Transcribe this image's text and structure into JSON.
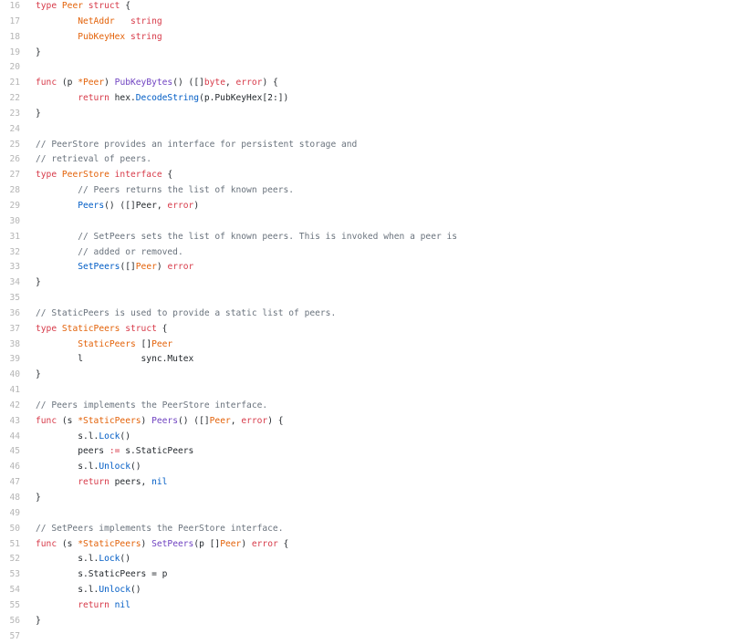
{
  "colors": {
    "keyword": "#d73a49",
    "function": "#6f42c1",
    "type": "#e36209",
    "comment": "#6a737d",
    "call": "#005cc5",
    "text": "#24292e",
    "line_number": "#b5b5b5",
    "background": "#ffffff"
  },
  "lines": [
    {
      "n": "16",
      "tokens": [
        [
          "kw",
          "type"
        ],
        [
          "t",
          " "
        ],
        [
          "type",
          "Peer"
        ],
        [
          "t",
          " "
        ],
        [
          "kw",
          "struct"
        ],
        [
          "t",
          " {"
        ]
      ]
    },
    {
      "n": "17",
      "tokens": [
        [
          "t",
          "\t"
        ],
        [
          "type",
          "NetAddr"
        ],
        [
          "t",
          "   "
        ],
        [
          "kw",
          "string"
        ]
      ]
    },
    {
      "n": "18",
      "tokens": [
        [
          "t",
          "\t"
        ],
        [
          "type",
          "PubKeyHex"
        ],
        [
          "t",
          " "
        ],
        [
          "kw",
          "string"
        ]
      ]
    },
    {
      "n": "19",
      "tokens": [
        [
          "t",
          "}"
        ]
      ]
    },
    {
      "n": "20",
      "tokens": []
    },
    {
      "n": "21",
      "tokens": [
        [
          "kw",
          "func"
        ],
        [
          "t",
          " (p "
        ],
        [
          "type",
          "*Peer"
        ],
        [
          "t",
          ") "
        ],
        [
          "fn",
          "PubKeyBytes"
        ],
        [
          "t",
          "() ([]"
        ],
        [
          "kw",
          "byte"
        ],
        [
          "t",
          ", "
        ],
        [
          "kw",
          "error"
        ],
        [
          "t",
          ") {"
        ]
      ]
    },
    {
      "n": "22",
      "tokens": [
        [
          "t",
          "\t"
        ],
        [
          "kw",
          "return"
        ],
        [
          "t",
          " hex."
        ],
        [
          "blue",
          "DecodeString"
        ],
        [
          "t",
          "(p.PubKeyHex[2:])"
        ]
      ]
    },
    {
      "n": "23",
      "tokens": [
        [
          "t",
          "}"
        ]
      ]
    },
    {
      "n": "24",
      "tokens": []
    },
    {
      "n": "25",
      "tokens": [
        [
          "com",
          "// PeerStore provides an interface for persistent storage and"
        ]
      ]
    },
    {
      "n": "26",
      "tokens": [
        [
          "com",
          "// retrieval of peers."
        ]
      ]
    },
    {
      "n": "27",
      "tokens": [
        [
          "kw",
          "type"
        ],
        [
          "t",
          " "
        ],
        [
          "type",
          "PeerStore"
        ],
        [
          "t",
          " "
        ],
        [
          "kw",
          "interface"
        ],
        [
          "t",
          " {"
        ]
      ]
    },
    {
      "n": "28",
      "tokens": [
        [
          "t",
          "\t"
        ],
        [
          "com",
          "// Peers returns the list of known peers."
        ]
      ]
    },
    {
      "n": "29",
      "tokens": [
        [
          "t",
          "\t"
        ],
        [
          "blue",
          "Peers"
        ],
        [
          "t",
          "() ([]Peer, "
        ],
        [
          "kw",
          "error"
        ],
        [
          "t",
          ")"
        ]
      ]
    },
    {
      "n": "30",
      "tokens": []
    },
    {
      "n": "31",
      "tokens": [
        [
          "t",
          "\t"
        ],
        [
          "com",
          "// SetPeers sets the list of known peers. This is invoked when a peer is"
        ]
      ]
    },
    {
      "n": "32",
      "tokens": [
        [
          "t",
          "\t"
        ],
        [
          "com",
          "// added or removed."
        ]
      ]
    },
    {
      "n": "33",
      "tokens": [
        [
          "t",
          "\t"
        ],
        [
          "blue",
          "SetPeers"
        ],
        [
          "t",
          "([]"
        ],
        [
          "type",
          "Peer"
        ],
        [
          "t",
          ") "
        ],
        [
          "kw",
          "error"
        ]
      ]
    },
    {
      "n": "34",
      "tokens": [
        [
          "t",
          "}"
        ]
      ]
    },
    {
      "n": "35",
      "tokens": []
    },
    {
      "n": "36",
      "tokens": [
        [
          "com",
          "// StaticPeers is used to provide a static list of peers."
        ]
      ]
    },
    {
      "n": "37",
      "tokens": [
        [
          "kw",
          "type"
        ],
        [
          "t",
          " "
        ],
        [
          "type",
          "StaticPeers"
        ],
        [
          "t",
          " "
        ],
        [
          "kw",
          "struct"
        ],
        [
          "t",
          " {"
        ]
      ]
    },
    {
      "n": "38",
      "tokens": [
        [
          "t",
          "\t"
        ],
        [
          "type",
          "StaticPeers"
        ],
        [
          "t",
          " []"
        ],
        [
          "type",
          "Peer"
        ]
      ]
    },
    {
      "n": "39",
      "tokens": [
        [
          "t",
          "\tl           sync.Mutex"
        ]
      ]
    },
    {
      "n": "40",
      "tokens": [
        [
          "t",
          "}"
        ]
      ]
    },
    {
      "n": "41",
      "tokens": []
    },
    {
      "n": "42",
      "tokens": [
        [
          "com",
          "// Peers implements the PeerStore interface."
        ]
      ]
    },
    {
      "n": "43",
      "tokens": [
        [
          "kw",
          "func"
        ],
        [
          "t",
          " (s "
        ],
        [
          "type",
          "*StaticPeers"
        ],
        [
          "t",
          ") "
        ],
        [
          "fn",
          "Peers"
        ],
        [
          "t",
          "() ([]"
        ],
        [
          "type",
          "Peer"
        ],
        [
          "t",
          ", "
        ],
        [
          "kw",
          "error"
        ],
        [
          "t",
          ") {"
        ]
      ]
    },
    {
      "n": "44",
      "tokens": [
        [
          "t",
          "\ts.l."
        ],
        [
          "blue",
          "Lock"
        ],
        [
          "t",
          "()"
        ]
      ]
    },
    {
      "n": "45",
      "tokens": [
        [
          "t",
          "\tpeers "
        ],
        [
          "kw",
          ":="
        ],
        [
          "t",
          " s.StaticPeers"
        ]
      ]
    },
    {
      "n": "46",
      "tokens": [
        [
          "t",
          "\ts.l."
        ],
        [
          "blue",
          "Unlock"
        ],
        [
          "t",
          "()"
        ]
      ]
    },
    {
      "n": "47",
      "tokens": [
        [
          "t",
          "\t"
        ],
        [
          "kw",
          "return"
        ],
        [
          "t",
          " peers, "
        ],
        [
          "blue",
          "nil"
        ]
      ]
    },
    {
      "n": "48",
      "tokens": [
        [
          "t",
          "}"
        ]
      ]
    },
    {
      "n": "49",
      "tokens": []
    },
    {
      "n": "50",
      "tokens": [
        [
          "com",
          "// SetPeers implements the PeerStore interface."
        ]
      ]
    },
    {
      "n": "51",
      "tokens": [
        [
          "kw",
          "func"
        ],
        [
          "t",
          " (s "
        ],
        [
          "type",
          "*StaticPeers"
        ],
        [
          "t",
          ") "
        ],
        [
          "fn",
          "SetPeers"
        ],
        [
          "t",
          "(p []"
        ],
        [
          "type",
          "Peer"
        ],
        [
          "t",
          ") "
        ],
        [
          "kw",
          "error"
        ],
        [
          "t",
          " {"
        ]
      ]
    },
    {
      "n": "52",
      "tokens": [
        [
          "t",
          "\ts.l."
        ],
        [
          "blue",
          "Lock"
        ],
        [
          "t",
          "()"
        ]
      ]
    },
    {
      "n": "53",
      "tokens": [
        [
          "t",
          "\ts.StaticPeers = p"
        ]
      ]
    },
    {
      "n": "54",
      "tokens": [
        [
          "t",
          "\ts.l."
        ],
        [
          "blue",
          "Unlock"
        ],
        [
          "t",
          "()"
        ]
      ]
    },
    {
      "n": "55",
      "tokens": [
        [
          "t",
          "\t"
        ],
        [
          "kw",
          "return"
        ],
        [
          "t",
          " "
        ],
        [
          "blue",
          "nil"
        ]
      ]
    },
    {
      "n": "56",
      "tokens": [
        [
          "t",
          "}"
        ]
      ]
    },
    {
      "n": "57",
      "tokens": []
    }
  ]
}
